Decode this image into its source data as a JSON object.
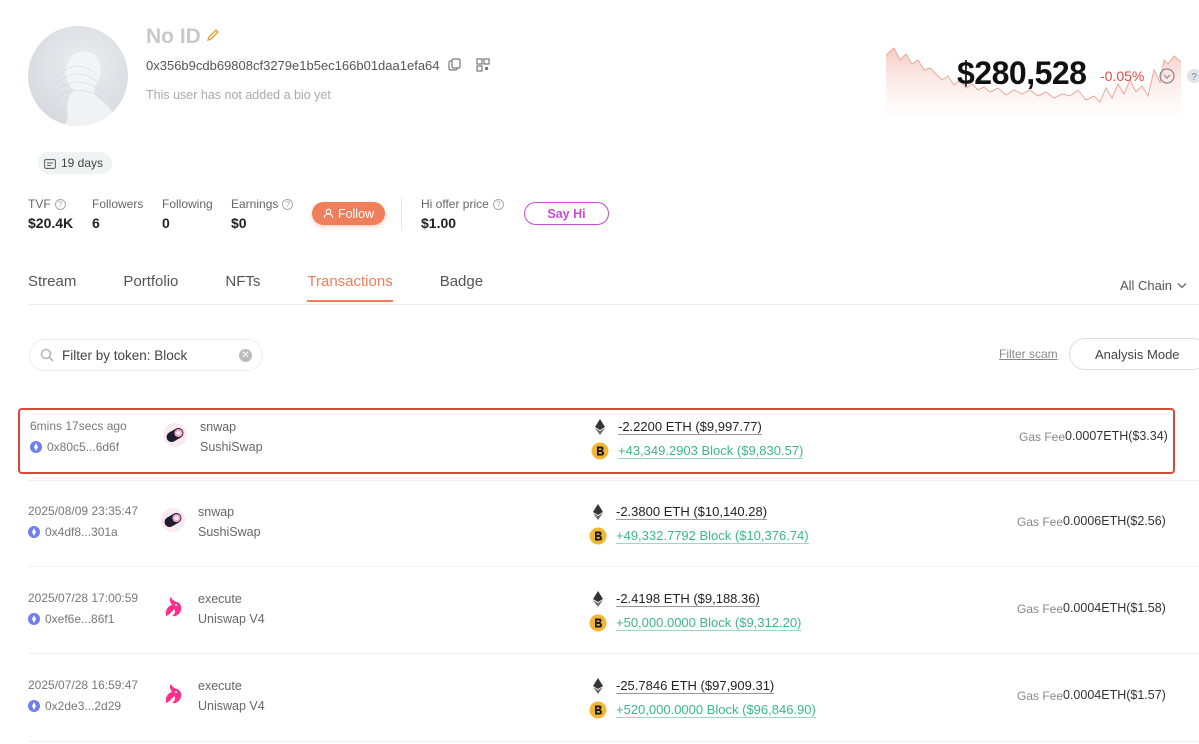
{
  "profile": {
    "name": "No ID",
    "address": "0x356b9cdb69808cf3279e1b5ec166b01daa1efa64",
    "bio": "This user has not added a bio yet",
    "days_badge": "19 days"
  },
  "networth": {
    "value": "$280,528",
    "change": "-0.05%"
  },
  "stats": {
    "tvf_label": "TVF",
    "tvf_value": "$20.4K",
    "followers_label": "Followers",
    "followers_value": "6",
    "following_label": "Following",
    "following_value": "0",
    "earnings_label": "Earnings",
    "earnings_value": "$0",
    "hi_offer_label": "Hi offer price",
    "hi_offer_value": "$1.00"
  },
  "buttons": {
    "follow": "Follow",
    "say_hi": "Say Hi",
    "filter_scam": "Filter scam",
    "analysis_mode": "Analysis Mode"
  },
  "tabs": [
    {
      "label": "Stream",
      "active": false
    },
    {
      "label": "Portfolio",
      "active": false
    },
    {
      "label": "NFTs",
      "active": false
    },
    {
      "label": "Transactions",
      "active": true
    },
    {
      "label": "Badge",
      "active": false
    }
  ],
  "chain_select": "All Chain",
  "search": {
    "value": "Filter by token: Block"
  },
  "transactions": [
    {
      "time": "6mins 17secs ago",
      "hash": "0x80c5...6d6f",
      "method": "snwap",
      "protocol": "SushiSwap",
      "protocol_icon": "sushiswap-icon",
      "out": "-2.2200 ETH ($9,997.77)",
      "in": "+43,349.2903 Block ($9,830.57)",
      "gas_label": "Gas Fee",
      "gas": "0.0007ETH($3.34)",
      "highlight": true
    },
    {
      "time": "2025/08/09 23:35:47",
      "hash": "0x4df8...301a",
      "method": "snwap",
      "protocol": "SushiSwap",
      "protocol_icon": "sushiswap-icon",
      "out": "-2.3800 ETH ($10,140.28)",
      "in": "+49,332.7792 Block ($10,376.74)",
      "gas_label": "Gas Fee",
      "gas": "0.0006ETH($2.56)",
      "highlight": false
    },
    {
      "time": "2025/07/28 17:00:59",
      "hash": "0xef6e...86f1",
      "method": "execute",
      "protocol": "Uniswap V4",
      "protocol_icon": "uniswap-icon",
      "out": "-2.4198 ETH ($9,188.36)",
      "in": "+50,000.0000 Block ($9,312.20)",
      "gas_label": "Gas Fee",
      "gas": "0.0004ETH($1.58)",
      "highlight": false
    },
    {
      "time": "2025/07/28 16:59:47",
      "hash": "0x2de3...2d29",
      "method": "execute",
      "protocol": "Uniswap V4",
      "protocol_icon": "uniswap-icon",
      "out": "-25.7846 ETH ($97,909.31)",
      "in": "+520,000.0000 Block ($96,846.90)",
      "gas_label": "Gas Fee",
      "gas": "0.0004ETH($1.57)",
      "highlight": false
    }
  ],
  "colors": {
    "accent": "#ee7f5a",
    "say_hi": "#c94ad6",
    "negative": "#e04a3b",
    "positive": "#3ab886",
    "highlight_border": "#d8473a"
  }
}
